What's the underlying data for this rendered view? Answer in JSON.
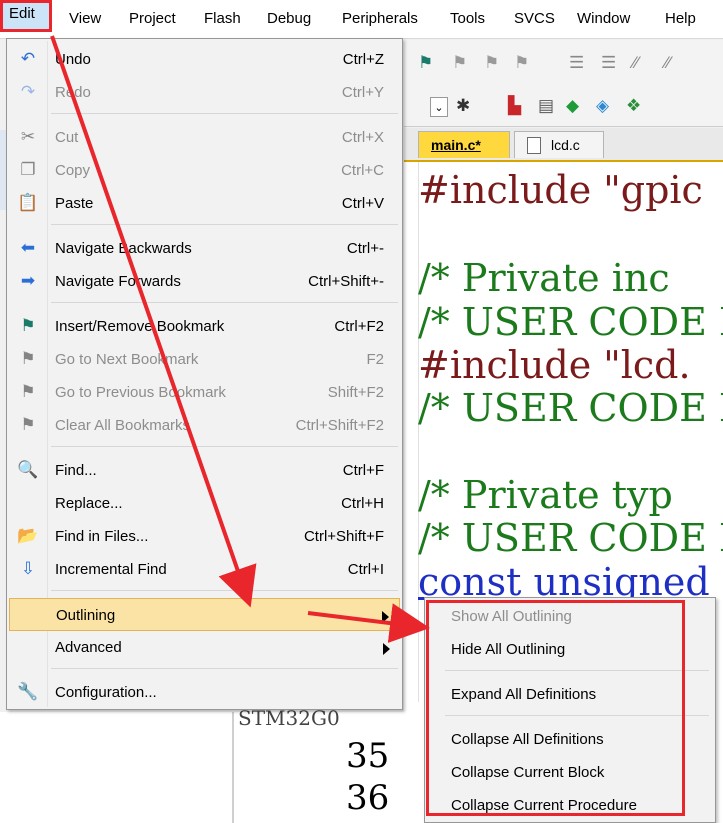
{
  "menubar": {
    "items": [
      "Edit",
      "View",
      "Project",
      "Flash",
      "Debug",
      "Peripherals",
      "Tools",
      "SVCS",
      "Window",
      "Help"
    ]
  },
  "tabs": {
    "main": "main.c*",
    "lcd": "lcd.c"
  },
  "code": {
    "lines": [
      "#include \"gpic",
      "/* Private inc",
      "/* USER CODE E",
      "#include \"lcd.",
      "/* USER CODE E",
      "/* Private typ",
      "/* USER CODE E",
      "const unsigned"
    ],
    "line_numbers": [
      "35",
      "36"
    ],
    "bg_fragment": "STM32G0"
  },
  "edit_menu": {
    "items": [
      {
        "label": "Undo",
        "shortcut": "Ctrl+Z",
        "icon": "undo-icon",
        "enabled": true
      },
      {
        "label": "Redo",
        "shortcut": "Ctrl+Y",
        "icon": "redo-icon",
        "enabled": false
      },
      {
        "label": "Cut",
        "shortcut": "Ctrl+X",
        "icon": "scissors-icon",
        "enabled": false
      },
      {
        "label": "Copy",
        "shortcut": "Ctrl+C",
        "icon": "copy-icon",
        "enabled": false
      },
      {
        "label": "Paste",
        "shortcut": "Ctrl+V",
        "icon": "paste-icon",
        "enabled": true
      },
      {
        "label": "Navigate Backwards",
        "shortcut": "Ctrl+-",
        "icon": "arrow-left-icon",
        "enabled": true
      },
      {
        "label": "Navigate Forwards",
        "shortcut": "Ctrl+Shift+-",
        "icon": "arrow-right-icon",
        "enabled": true
      },
      {
        "label": "Insert/Remove Bookmark",
        "shortcut": "Ctrl+F2",
        "icon": "bookmark-flag-icon",
        "enabled": true
      },
      {
        "label": "Go to Next Bookmark",
        "shortcut": "F2",
        "icon": "next-bookmark-icon",
        "enabled": false
      },
      {
        "label": "Go to Previous Bookmark",
        "shortcut": "Shift+F2",
        "icon": "prev-bookmark-icon",
        "enabled": false
      },
      {
        "label": "Clear All Bookmarks",
        "shortcut": "Ctrl+Shift+F2",
        "icon": "clear-bookmarks-icon",
        "enabled": false
      },
      {
        "label": "Find...",
        "shortcut": "Ctrl+F",
        "icon": "find-icon",
        "enabled": true
      },
      {
        "label": "Replace...",
        "shortcut": "Ctrl+H",
        "icon": "",
        "enabled": true
      },
      {
        "label": "Find in Files...",
        "shortcut": "Ctrl+Shift+F",
        "icon": "find-in-files-icon",
        "enabled": true
      },
      {
        "label": "Incremental Find",
        "shortcut": "Ctrl+I",
        "icon": "incremental-find-icon",
        "enabled": true
      },
      {
        "label": "Outlining",
        "shortcut": "",
        "icon": "",
        "enabled": true
      },
      {
        "label": "Advanced",
        "shortcut": "",
        "icon": "",
        "enabled": true
      },
      {
        "label": "Configuration...",
        "shortcut": "",
        "icon": "wrench-icon",
        "enabled": true
      }
    ]
  },
  "outlining_submenu": {
    "items": [
      {
        "label": "Show All Outlining",
        "enabled": false
      },
      {
        "label": "Hide All Outlining",
        "enabled": true
      },
      {
        "label": "Expand All Definitions",
        "enabled": true
      },
      {
        "label": "Collapse All Definitions",
        "enabled": true
      },
      {
        "label": "Collapse Current Block",
        "enabled": true
      },
      {
        "label": "Collapse Current Procedure",
        "enabled": true
      }
    ]
  },
  "colors": {
    "annotation": "#e8262b",
    "highlight": "#fbe3a6",
    "tab_active": "#ffd83d"
  }
}
